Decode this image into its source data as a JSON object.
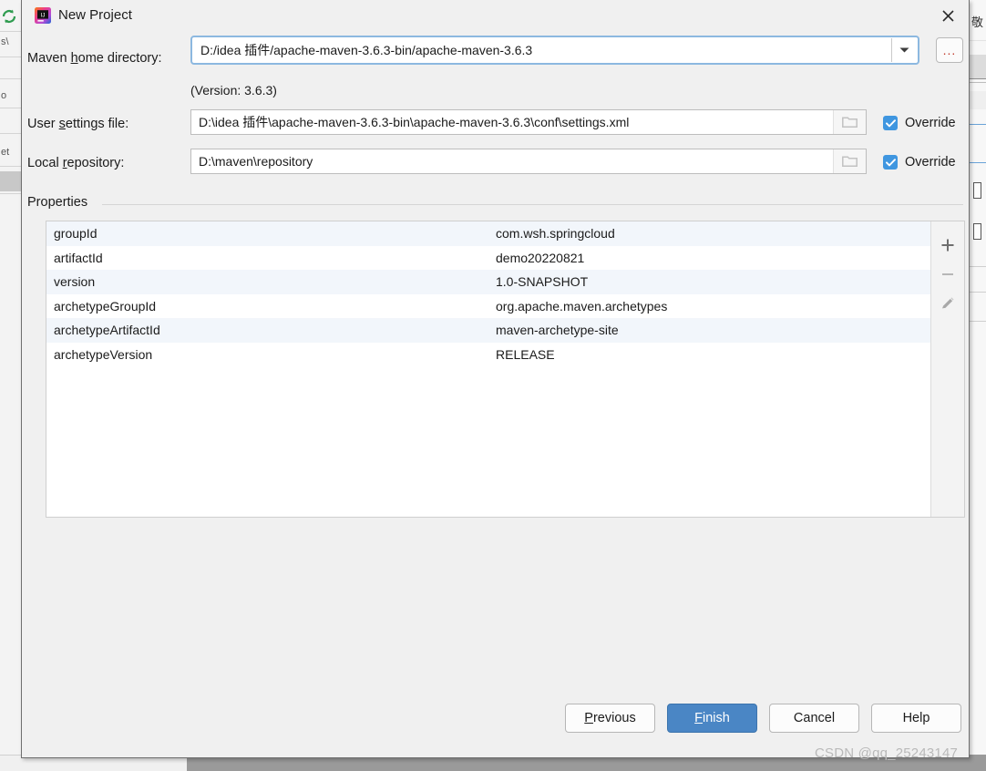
{
  "background": {
    "left_labels": [
      "s\\",
      "o",
      "et"
    ],
    "right_cjk": "敬"
  },
  "dialog": {
    "title": "New Project",
    "app_icon": "intellij-idea-icon",
    "close_icon": "close-icon"
  },
  "form": {
    "maven_home": {
      "label_before": "Maven ",
      "label_mnemonic": "h",
      "label_after": "ome directory:",
      "value": "D:/idea 插件/apache-maven-3.6.3-bin/apache-maven-3.6.3",
      "placeholder": "Maven home directory",
      "dropdown_icon": "chevron-down-icon",
      "browse_label": "...",
      "version_note": "(Version: 3.6.3)"
    },
    "user_settings": {
      "label_before": "User ",
      "label_mnemonic": "s",
      "label_after": "ettings file:",
      "value": "D:\\idea 插件\\apache-maven-3.6.3-bin\\apache-maven-3.6.3\\conf\\settings.xml",
      "placeholder": "User settings file",
      "folder_icon": "folder-icon",
      "override_label": "Override",
      "override_checked": true
    },
    "local_repository": {
      "label_before": "Local ",
      "label_mnemonic": "r",
      "label_after": "epository:",
      "value": "D:\\maven\\repository",
      "placeholder": "Local repository",
      "folder_icon": "folder-icon",
      "override_label": "Override",
      "override_checked": true
    }
  },
  "properties": {
    "section_title": "Properties",
    "rows": [
      {
        "key": "groupId",
        "value": "com.wsh.springcloud"
      },
      {
        "key": "artifactId",
        "value": "demo20220821"
      },
      {
        "key": "version",
        "value": "1.0-SNAPSHOT"
      },
      {
        "key": "archetypeGroupId",
        "value": "org.apache.maven.archetypes"
      },
      {
        "key": "archetypeArtifactId",
        "value": "maven-archetype-site"
      },
      {
        "key": "archetypeVersion",
        "value": "RELEASE"
      }
    ],
    "toolbar": {
      "add_icon": "plus-icon",
      "remove_icon": "minus-icon",
      "edit_icon": "pencil-icon"
    }
  },
  "footer": {
    "previous": {
      "before": "",
      "mnemonic": "P",
      "after": "revious"
    },
    "finish": {
      "before": "",
      "mnemonic": "F",
      "after": "inish"
    },
    "cancel": {
      "before": "Cancel",
      "mnemonic": "",
      "after": ""
    },
    "help": {
      "before": "Help",
      "mnemonic": "",
      "after": ""
    }
  },
  "watermark": "CSDN @qq_25243147",
  "colors": {
    "accent": "#4a86c5",
    "checkbox": "#3f96e0",
    "focus_ring": "#8cb8e0",
    "alt_row": "#f2f6fb",
    "dialog_bg": "#f0f0f0"
  }
}
